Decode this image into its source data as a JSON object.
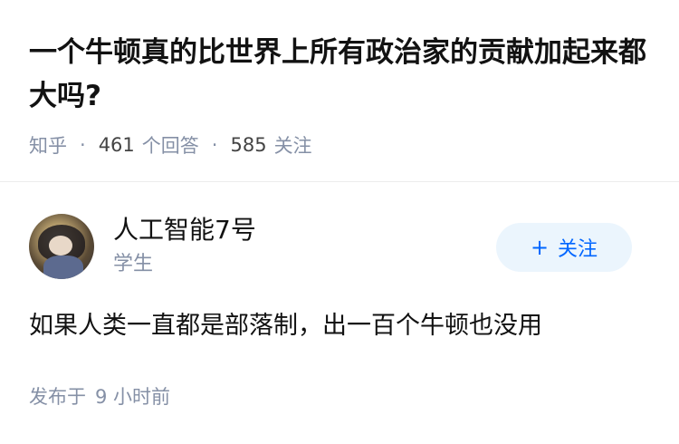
{
  "question": {
    "title": "一个牛顿真的比世界上所有政治家的贡献加起来都大吗?",
    "source": "知乎",
    "separator": "·",
    "answer_count": "461",
    "answer_label": "个回答",
    "follower_count": "585",
    "follower_label": "关注"
  },
  "author": {
    "name": "人工智能7号",
    "headline": "学生",
    "avatar_icon": "avatar-image"
  },
  "follow_button": {
    "icon": "plus-icon",
    "plus": "+",
    "label": "关注"
  },
  "answer": {
    "content": "如果人类一直都是部落制，出一百个牛顿也没用",
    "time_prefix": "发布于",
    "time_value": "9 小时前"
  },
  "colors": {
    "text": "#121212",
    "muted": "#8590a6",
    "accent": "#0066ff",
    "follow_bg": "#ebf5fd"
  }
}
